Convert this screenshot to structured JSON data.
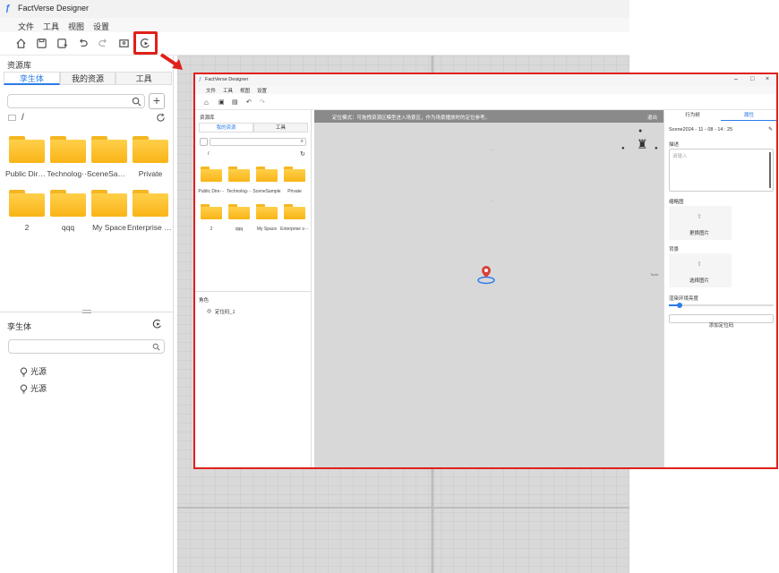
{
  "app": {
    "title": "FactVerse Designer"
  },
  "menu": [
    "文件",
    "工具",
    "视图",
    "设置"
  ],
  "left_panel": {
    "section_title": "资源库",
    "tabs": [
      "孪生体",
      "我的资源",
      "工具"
    ],
    "path": "/",
    "folders": [
      "Public Dire···",
      "Technolog···",
      "SceneSample",
      "Private",
      "2",
      "qqq",
      "My Space",
      "Enterprise s···"
    ],
    "twin_section_title": "孪生体",
    "twin_items": [
      "光源",
      "光源"
    ]
  },
  "inset": {
    "title": "FactVerse Designer",
    "menu": [
      "文件",
      "工具",
      "视图",
      "设置"
    ],
    "left_section_title": "资源库",
    "tabs": [
      "我的资源",
      "工具"
    ],
    "path": "/",
    "folders": [
      "Public Dire···",
      "Technolog···",
      "SceneSample",
      "Private",
      "2",
      "qqq",
      "My Space",
      "Enterprise s···"
    ],
    "role_section_title": "角色",
    "role_item": "定位码_1",
    "banner_text": "定位模式：可拖拽资源区模型进入场景区，作为场景播放时的定位参考。",
    "exit_label": "退出",
    "right_tabs": [
      "行为树",
      "属性"
    ],
    "scene_name": "Scene2024 - 11 - 08 - 14 : 25",
    "desc_label": "描述",
    "desc_placeholder": "请输入",
    "thumb_label": "缩略图",
    "thumb_upload": "更换图片",
    "bg_label": "背景",
    "bg_upload": "选择图片",
    "brightness_label": "渲染环境亮度",
    "add_button": "添加定位码",
    "vp_labels": [
      "…",
      "…",
      "Tools"
    ]
  },
  "colors": {
    "accent": "#2b7de9",
    "highlight": "#e0201a",
    "folder": "#f9b418"
  }
}
